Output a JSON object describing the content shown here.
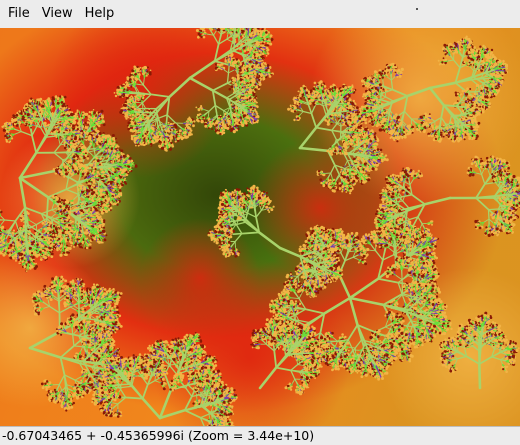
{
  "menubar": {
    "items": [
      {
        "label": "File"
      },
      {
        "label": "View"
      },
      {
        "label": "Help"
      }
    ]
  },
  "viewer": {
    "palette": {
      "deep_green": "#123d05",
      "dark_green": "#2f6a0c",
      "red": "#e0230f",
      "dark_red": "#8a1a05",
      "orange": "#f0861c",
      "yellow_orange": "#f2b446",
      "bright_green": "#66e03a",
      "pale_green": "#a8d36a",
      "purple": "#7a3bb0"
    }
  },
  "status": {
    "text": "-0.67043465 + -0.45365996i (Zoom = 3.44e+10)"
  }
}
